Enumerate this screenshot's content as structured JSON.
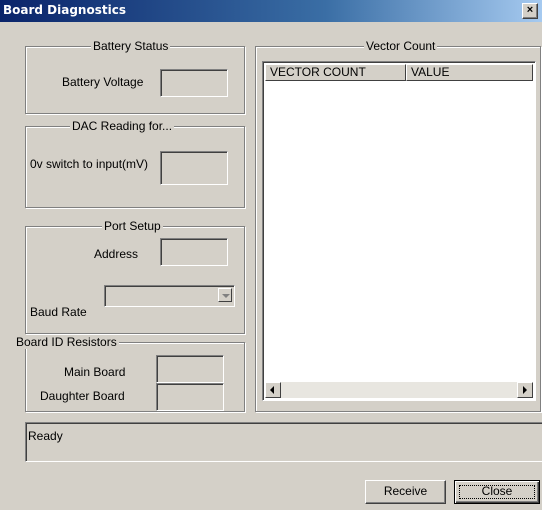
{
  "window": {
    "title": "Board Diagnostics",
    "close_glyph": "×"
  },
  "battery": {
    "group_title": "Battery Status",
    "voltage_label": "Battery Voltage",
    "voltage_value": ""
  },
  "dac": {
    "group_title": "DAC Reading for...",
    "switch_label": "0v switch to input(mV)",
    "switch_value": ""
  },
  "port": {
    "group_title": "Port Setup",
    "address_label": "Address",
    "address_value": "",
    "baud_label": "Baud Rate",
    "baud_value": ""
  },
  "board_id": {
    "group_title": "Board ID Resistors",
    "main_label": "Main Board",
    "main_value": "",
    "daughter_label": "Daughter Board",
    "daughter_value": ""
  },
  "vector": {
    "group_title": "Vector Count",
    "columns": [
      "VECTOR COUNT",
      "VALUE"
    ]
  },
  "status": {
    "text": "Ready"
  },
  "buttons": {
    "receive": "Receive",
    "close": "Close"
  }
}
